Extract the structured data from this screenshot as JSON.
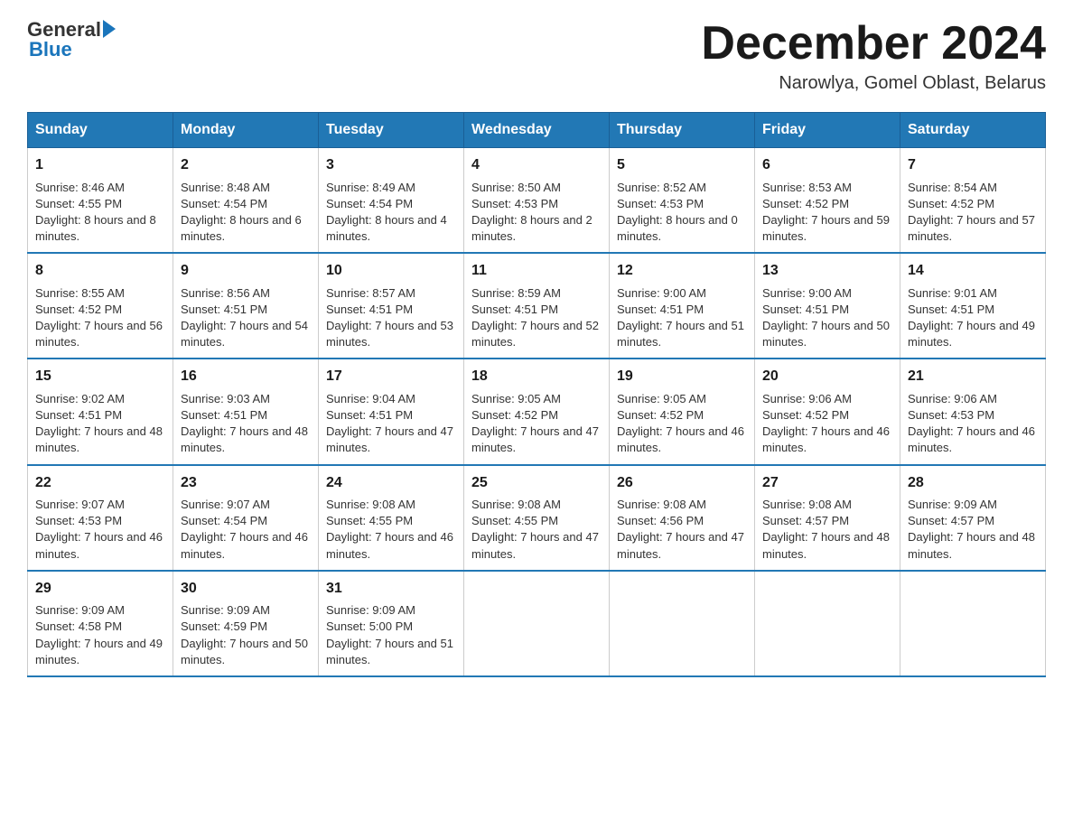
{
  "logo": {
    "text1": "General",
    "text2": "Blue"
  },
  "header": {
    "month": "December 2024",
    "location": "Narowlya, Gomel Oblast, Belarus"
  },
  "days_of_week": [
    "Sunday",
    "Monday",
    "Tuesday",
    "Wednesday",
    "Thursday",
    "Friday",
    "Saturday"
  ],
  "weeks": [
    [
      {
        "day": "1",
        "sunrise": "8:46 AM",
        "sunset": "4:55 PM",
        "daylight": "8 hours and 8 minutes."
      },
      {
        "day": "2",
        "sunrise": "8:48 AM",
        "sunset": "4:54 PM",
        "daylight": "8 hours and 6 minutes."
      },
      {
        "day": "3",
        "sunrise": "8:49 AM",
        "sunset": "4:54 PM",
        "daylight": "8 hours and 4 minutes."
      },
      {
        "day": "4",
        "sunrise": "8:50 AM",
        "sunset": "4:53 PM",
        "daylight": "8 hours and 2 minutes."
      },
      {
        "day": "5",
        "sunrise": "8:52 AM",
        "sunset": "4:53 PM",
        "daylight": "8 hours and 0 minutes."
      },
      {
        "day": "6",
        "sunrise": "8:53 AM",
        "sunset": "4:52 PM",
        "daylight": "7 hours and 59 minutes."
      },
      {
        "day": "7",
        "sunrise": "8:54 AM",
        "sunset": "4:52 PM",
        "daylight": "7 hours and 57 minutes."
      }
    ],
    [
      {
        "day": "8",
        "sunrise": "8:55 AM",
        "sunset": "4:52 PM",
        "daylight": "7 hours and 56 minutes."
      },
      {
        "day": "9",
        "sunrise": "8:56 AM",
        "sunset": "4:51 PM",
        "daylight": "7 hours and 54 minutes."
      },
      {
        "day": "10",
        "sunrise": "8:57 AM",
        "sunset": "4:51 PM",
        "daylight": "7 hours and 53 minutes."
      },
      {
        "day": "11",
        "sunrise": "8:59 AM",
        "sunset": "4:51 PM",
        "daylight": "7 hours and 52 minutes."
      },
      {
        "day": "12",
        "sunrise": "9:00 AM",
        "sunset": "4:51 PM",
        "daylight": "7 hours and 51 minutes."
      },
      {
        "day": "13",
        "sunrise": "9:00 AM",
        "sunset": "4:51 PM",
        "daylight": "7 hours and 50 minutes."
      },
      {
        "day": "14",
        "sunrise": "9:01 AM",
        "sunset": "4:51 PM",
        "daylight": "7 hours and 49 minutes."
      }
    ],
    [
      {
        "day": "15",
        "sunrise": "9:02 AM",
        "sunset": "4:51 PM",
        "daylight": "7 hours and 48 minutes."
      },
      {
        "day": "16",
        "sunrise": "9:03 AM",
        "sunset": "4:51 PM",
        "daylight": "7 hours and 48 minutes."
      },
      {
        "day": "17",
        "sunrise": "9:04 AM",
        "sunset": "4:51 PM",
        "daylight": "7 hours and 47 minutes."
      },
      {
        "day": "18",
        "sunrise": "9:05 AM",
        "sunset": "4:52 PM",
        "daylight": "7 hours and 47 minutes."
      },
      {
        "day": "19",
        "sunrise": "9:05 AM",
        "sunset": "4:52 PM",
        "daylight": "7 hours and 46 minutes."
      },
      {
        "day": "20",
        "sunrise": "9:06 AM",
        "sunset": "4:52 PM",
        "daylight": "7 hours and 46 minutes."
      },
      {
        "day": "21",
        "sunrise": "9:06 AM",
        "sunset": "4:53 PM",
        "daylight": "7 hours and 46 minutes."
      }
    ],
    [
      {
        "day": "22",
        "sunrise": "9:07 AM",
        "sunset": "4:53 PM",
        "daylight": "7 hours and 46 minutes."
      },
      {
        "day": "23",
        "sunrise": "9:07 AM",
        "sunset": "4:54 PM",
        "daylight": "7 hours and 46 minutes."
      },
      {
        "day": "24",
        "sunrise": "9:08 AM",
        "sunset": "4:55 PM",
        "daylight": "7 hours and 46 minutes."
      },
      {
        "day": "25",
        "sunrise": "9:08 AM",
        "sunset": "4:55 PM",
        "daylight": "7 hours and 47 minutes."
      },
      {
        "day": "26",
        "sunrise": "9:08 AM",
        "sunset": "4:56 PM",
        "daylight": "7 hours and 47 minutes."
      },
      {
        "day": "27",
        "sunrise": "9:08 AM",
        "sunset": "4:57 PM",
        "daylight": "7 hours and 48 minutes."
      },
      {
        "day": "28",
        "sunrise": "9:09 AM",
        "sunset": "4:57 PM",
        "daylight": "7 hours and 48 minutes."
      }
    ],
    [
      {
        "day": "29",
        "sunrise": "9:09 AM",
        "sunset": "4:58 PM",
        "daylight": "7 hours and 49 minutes."
      },
      {
        "day": "30",
        "sunrise": "9:09 AM",
        "sunset": "4:59 PM",
        "daylight": "7 hours and 50 minutes."
      },
      {
        "day": "31",
        "sunrise": "9:09 AM",
        "sunset": "5:00 PM",
        "daylight": "7 hours and 51 minutes."
      },
      null,
      null,
      null,
      null
    ]
  ]
}
